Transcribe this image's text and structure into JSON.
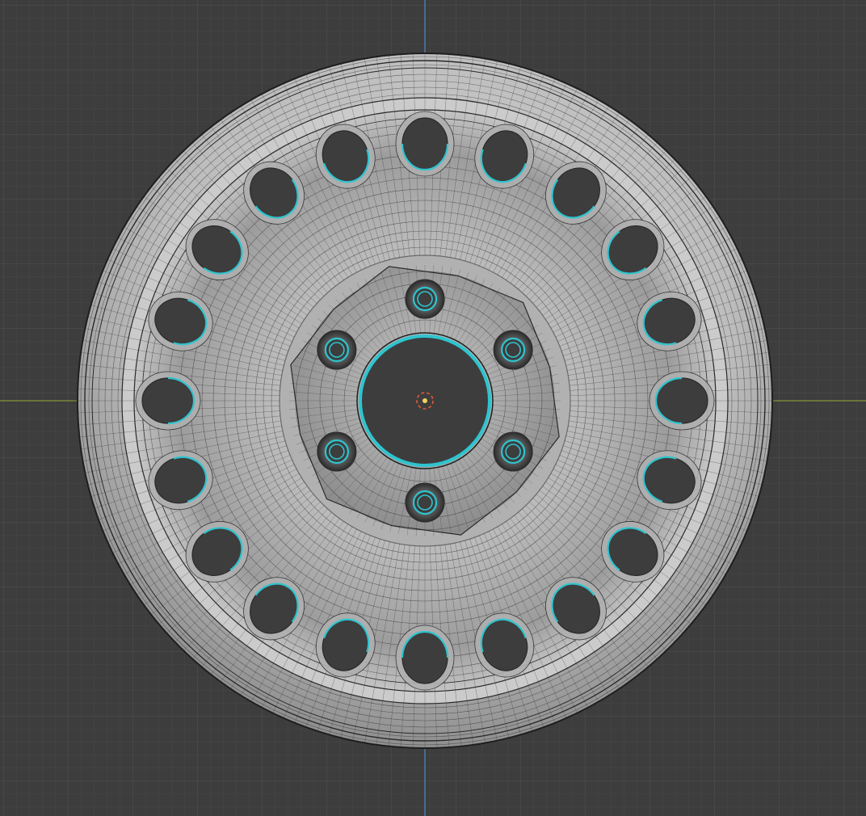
{
  "viewport": {
    "view": "orthographic-front",
    "grid_visible": true,
    "colors": {
      "background": "#3d3d3d",
      "grid_minor": "#474747",
      "grid_major": "#515151",
      "x_axis": "#7c8a3a",
      "z_axis": "#4d7fb8",
      "mesh_face": "#c9c9c9",
      "mesh_face_shadow": "#8a8a8a",
      "wireframe": "#2a2a2a",
      "selected_edge": "#2ec4cf",
      "origin_marker": "#e05a3a"
    }
  },
  "object": {
    "type": "wheel-rim",
    "outer_holes": 20,
    "lug_nuts": 6,
    "center_bore": 1,
    "wireframe_overlay": true,
    "selected_edges": "hole-rims"
  },
  "icons": {
    "origin": "object-origin-icon"
  }
}
